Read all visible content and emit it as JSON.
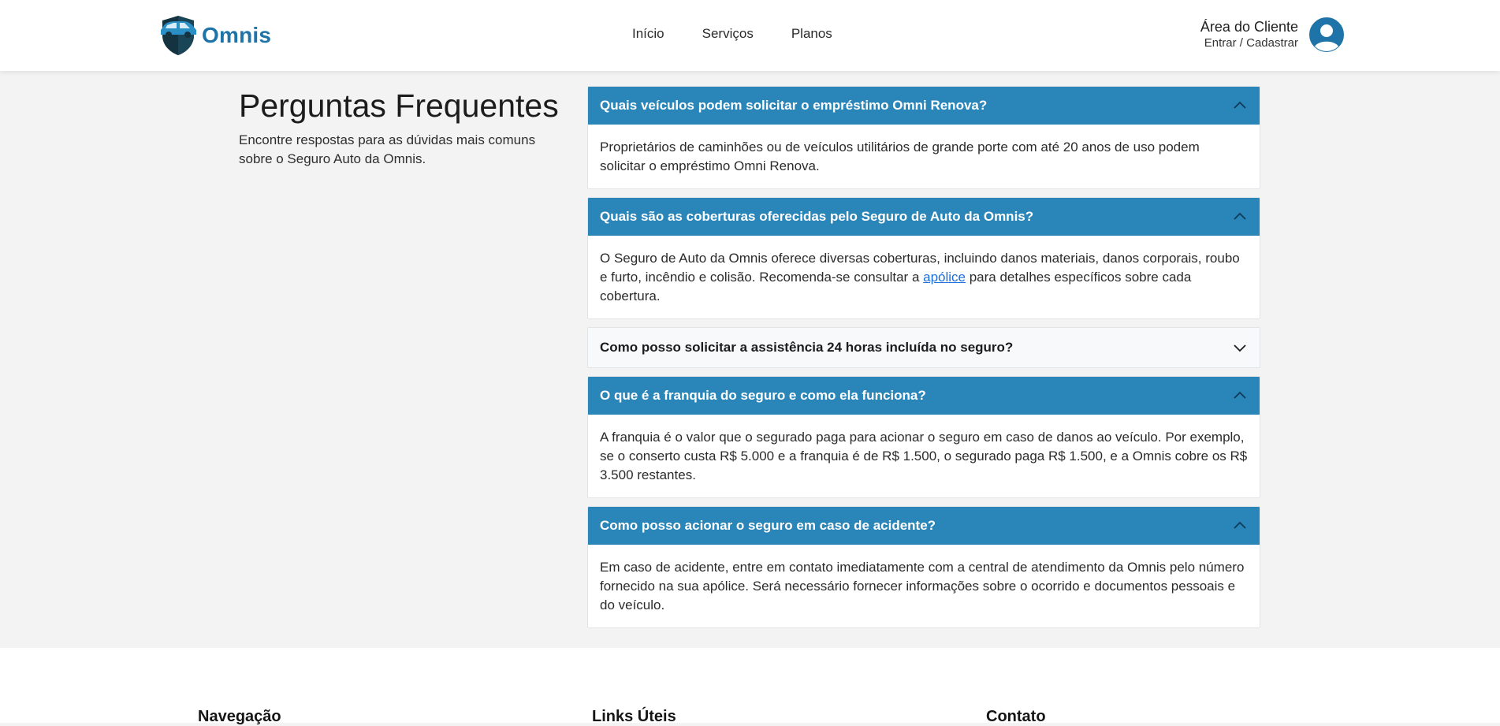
{
  "brand": {
    "name": "Omnis",
    "color": "#1e73a8"
  },
  "nav": {
    "items": [
      "Início",
      "Serviços",
      "Planos"
    ]
  },
  "client": {
    "title": "Área do Cliente",
    "subtitle": "Entrar / Cadastrar"
  },
  "intro": {
    "title": "Perguntas Frequentes",
    "description": "Encontre respostas para as dúvidas mais comuns sobre o Seguro Auto da Omnis."
  },
  "faq": [
    {
      "question": "Quais veículos podem solicitar o empréstimo Omni Renova?",
      "answer": "Proprietários de caminhões ou de veículos utilitários de grande porte com até 20 anos de uso podem solicitar o empréstimo Omni Renova.",
      "open": true
    },
    {
      "question": "Quais são as coberturas oferecidas pelo Seguro de Auto da Omnis?",
      "answer_before": "O Seguro de Auto da Omnis oferece diversas coberturas, incluindo danos materiais, danos corporais, roubo e furto, incêndio e colisão. Recomenda-se consultar a ",
      "answer_link": "apólice",
      "answer_after": " para detalhes específicos sobre cada cobertura.",
      "open": true
    },
    {
      "question": "Como posso solicitar a assistência 24 horas incluída no seguro?",
      "open": false
    },
    {
      "question": "O que é a franquia do seguro e como ela funciona?",
      "answer": "A franquia é o valor que o segurado paga para acionar o seguro em caso de danos ao veículo. Por exemplo, se o conserto custa R$ 5.000 e a franquia é de R$ 1.500, o segurado paga R$ 1.500, e a Omnis cobre os R$ 3.500 restantes.",
      "open": true
    },
    {
      "question": "Como posso acionar o seguro em caso de acidente?",
      "answer": "Em caso de acidente, entre em contato imediatamente com a central de atendimento da Omnis pelo número fornecido na sua apólice. Será necessário fornecer informações sobre o ocorrido e documentos pessoais e do veículo.",
      "open": true
    }
  ],
  "footer": {
    "columns": [
      "Navegação",
      "Links Úteis",
      "Contato"
    ]
  },
  "colors": {
    "accent": "#2a85b8",
    "background": "#f3f3f3",
    "link": "#1a6fdb"
  },
  "icons": {
    "open": "chevron-up-icon",
    "closed": "chevron-down-icon",
    "avatar": "user-avatar-icon",
    "logo": "shield-car-logo"
  }
}
